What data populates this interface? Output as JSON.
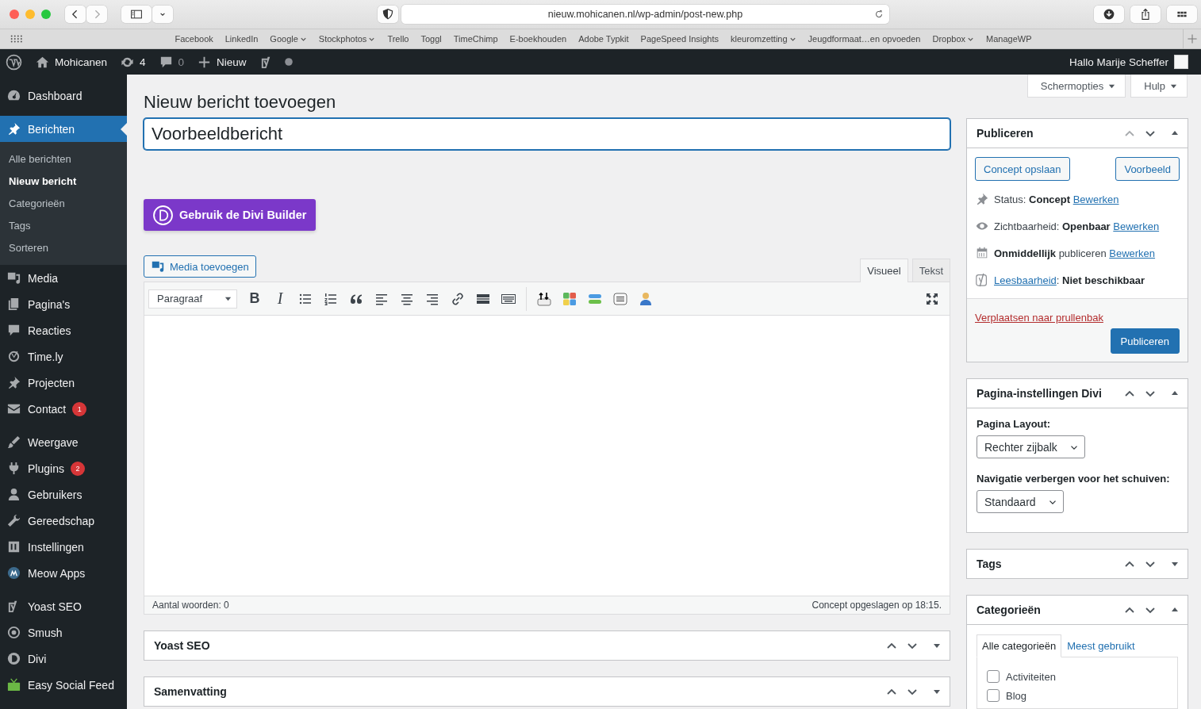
{
  "browser": {
    "url": "nieuw.mohicanen.nl/wp-admin/post-new.php",
    "bookmarks": [
      {
        "label": "Facebook",
        "menu": false
      },
      {
        "label": "LinkedIn",
        "menu": false
      },
      {
        "label": "Google",
        "menu": true
      },
      {
        "label": "Stockphotos",
        "menu": true
      },
      {
        "label": "Trello",
        "menu": false
      },
      {
        "label": "Toggl",
        "menu": false
      },
      {
        "label": "TimeChimp",
        "menu": false
      },
      {
        "label": "E-boekhouden",
        "menu": false
      },
      {
        "label": "Adobe Typkit",
        "menu": false
      },
      {
        "label": "PageSpeed Insights",
        "menu": false
      },
      {
        "label": "kleuromzetting",
        "menu": true
      },
      {
        "label": "Jeugdformaat…en opvoeden",
        "menu": false
      },
      {
        "label": "Dropbox",
        "menu": true
      },
      {
        "label": "ManageWP",
        "menu": false
      }
    ]
  },
  "admin_bar": {
    "site": "Mohicanen",
    "updates": "4",
    "comments": "0",
    "new": "Nieuw",
    "greeting": "Hallo Marije Scheffer"
  },
  "sidebar": {
    "groups": [
      {
        "items": [
          {
            "label": "Dashboard",
            "selected": false
          }
        ]
      },
      {
        "items": [
          {
            "label": "Berichten",
            "selected": true,
            "children": [
              {
                "label": "Alle berichten",
                "selected": false
              },
              {
                "label": "Nieuw bericht",
                "selected": true
              },
              {
                "label": "Categorieën",
                "selected": false
              },
              {
                "label": "Tags",
                "selected": false
              },
              {
                "label": "Sorteren",
                "selected": false
              }
            ]
          },
          {
            "label": "Media",
            "selected": false
          },
          {
            "label": "Pagina's",
            "selected": false
          },
          {
            "label": "Reacties",
            "selected": false
          },
          {
            "label": "Time.ly",
            "selected": false
          },
          {
            "label": "Projecten",
            "selected": false
          },
          {
            "label": "Contact",
            "selected": false,
            "badge": "1"
          }
        ]
      },
      {
        "items": [
          {
            "label": "Weergave",
            "selected": false
          },
          {
            "label": "Plugins",
            "selected": false,
            "badge": "2"
          },
          {
            "label": "Gebruikers",
            "selected": false
          },
          {
            "label": "Gereedschap",
            "selected": false
          },
          {
            "label": "Instellingen",
            "selected": false
          },
          {
            "label": "Meow Apps",
            "selected": false
          }
        ]
      },
      {
        "items": [
          {
            "label": "Yoast SEO",
            "selected": false
          },
          {
            "label": "Smush",
            "selected": false
          },
          {
            "label": "Divi",
            "selected": false
          },
          {
            "label": "Easy Social Feed",
            "selected": false
          }
        ]
      }
    ]
  },
  "screen_options": "Schermopties",
  "help": "Hulp",
  "page_title": "Nieuw bericht toevoegen",
  "title_field": {
    "value": "Voorbeeldbericht"
  },
  "divi_button": "Gebruik de Divi Builder",
  "editor": {
    "media_button": "Media toevoegen",
    "tabs": [
      {
        "label": "Visueel",
        "selected": true
      },
      {
        "label": "Tekst",
        "selected": false
      }
    ],
    "format": "Paragraaf",
    "bold": "B",
    "italic": "I",
    "word_count": "Aantal woorden: 0",
    "saved": "Concept opgeslagen op 18:15."
  },
  "metaboxes": [
    {
      "title": "Yoast SEO",
      "expanded": false
    },
    {
      "title": "Samenvatting",
      "expanded": false
    }
  ],
  "publish": {
    "title": "Publiceren",
    "expanded": true,
    "save": "Concept opslaan",
    "preview": "Voorbeeld",
    "rows": [
      {
        "text": "Status: **Concept**",
        "link": "Bewerken",
        "link_first": false
      },
      {
        "text": "Zichtbaarheid: **Openbaar**",
        "link": "Bewerken",
        "link_first": false
      },
      {
        "text": "**Onmiddellijk** publiceren",
        "link": "Bewerken",
        "link_first": false
      },
      {
        "text": ": **Niet beschikbaar**",
        "link": "Leesbaarheid",
        "link_first": true
      }
    ],
    "trash": "Verplaatsen naar prullenbak",
    "button": "Publiceren"
  },
  "divi_box": {
    "title": "Pagina-instellingen Divi",
    "expanded": true,
    "fields": [
      {
        "label": "Pagina Layout:",
        "value": "Rechter zijbalk"
      },
      {
        "label": "Navigatie verbergen voor het schuiven:",
        "value": "Standaard"
      }
    ]
  },
  "tags_box": {
    "title": "Tags",
    "expanded": false
  },
  "categories": {
    "title": "Categorieën",
    "expanded": true,
    "tabs": [
      {
        "label": "Alle categorieën",
        "selected": true
      },
      {
        "label": "Meest gebruikt",
        "selected": false
      }
    ],
    "items": [
      {
        "label": "Activiteiten",
        "checked": false
      },
      {
        "label": "Blog",
        "checked": false
      }
    ]
  }
}
